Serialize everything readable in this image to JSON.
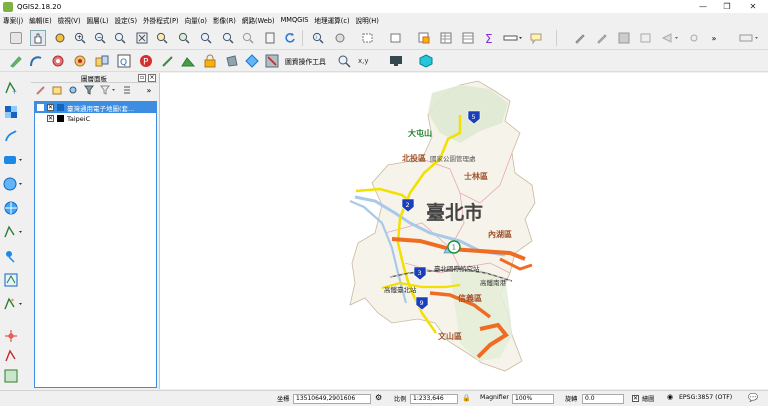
{
  "window": {
    "title": "QGIS2.18.20",
    "minimize_icon": "minimize-icon",
    "restore_icon": "restore-icon",
    "close_icon": "close-icon"
  },
  "menu": [
    "專案(j)",
    "編輯(E)",
    "檢視(V)",
    "圖層(L)",
    "設定(S)",
    "外掛程式(P)",
    "向量(o)",
    "影像(R)",
    "網路(Web)",
    "MMQGIS",
    "地理運算(c)",
    "說明(H)"
  ],
  "toolbar2": {
    "adv_digitize_label": "圖資操作工具"
  },
  "layers_panel": {
    "title": "圖層面板",
    "layers": [
      {
        "name": "臺灣通用電子地圖(套...",
        "checked": "✕",
        "selected": true
      },
      {
        "name": "TaipeiC",
        "checked": "✕",
        "selected": false
      }
    ]
  },
  "map": {
    "title": "臺北市",
    "labels": [
      "大屯山",
      "北投區",
      "國家公園管理處",
      "士林區",
      "內湖區",
      "臺北國際航空站",
      "高鐵南港",
      "高鐵臺北站",
      "信義區",
      "文山區"
    ],
    "shields": [
      "2",
      "1",
      "3",
      "5",
      "9"
    ]
  },
  "status": {
    "coord_label": "坐標",
    "coord_value": "13510649,2901606",
    "scale_label": "比例",
    "scale_value": "1:233,646",
    "magnifier_label": "Magnifier",
    "magnifier_value": "100%",
    "rotation_label": "旋轉",
    "rotation_value": "0.0",
    "render_label": "繪圖",
    "render_checked": "✕",
    "crs_label": "EPSG:3857 (OTF)"
  }
}
